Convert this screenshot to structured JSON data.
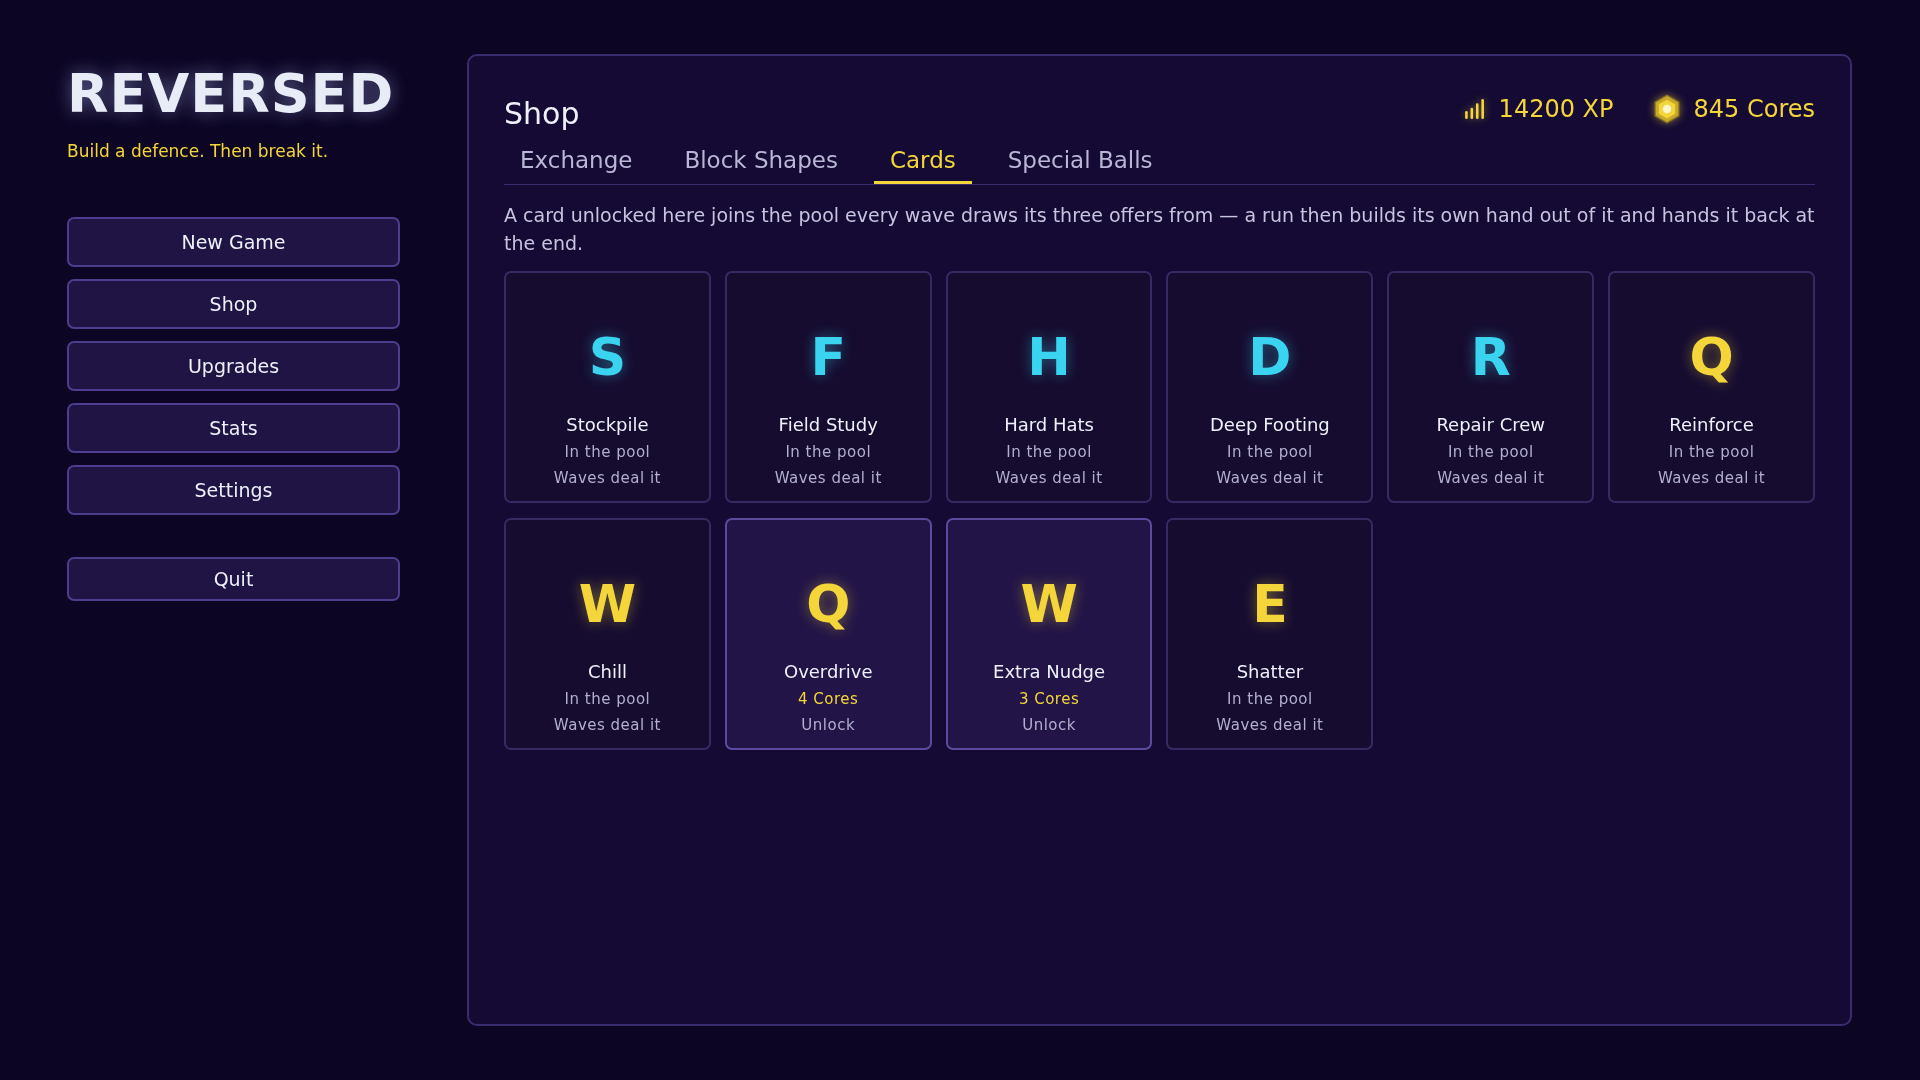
{
  "app": {
    "title": "REVERSED",
    "tagline": "Build a defence. Then break it."
  },
  "menu": [
    {
      "label": "New Game",
      "kind": "main"
    },
    {
      "label": "Shop",
      "kind": "main"
    },
    {
      "label": "Upgrades",
      "kind": "main"
    },
    {
      "label": "Stats",
      "kind": "main"
    },
    {
      "label": "Settings",
      "kind": "main"
    },
    {
      "label": "Quit",
      "kind": "exit"
    }
  ],
  "shop": {
    "title": "Shop",
    "xp": "14200 XP",
    "cores": "845 Cores",
    "tabs": [
      {
        "label": "Exchange",
        "selected": false
      },
      {
        "label": "Block Shapes",
        "selected": false
      },
      {
        "label": "Cards",
        "selected": true
      },
      {
        "label": "Special Balls",
        "selected": false
      }
    ],
    "description": "A card unlocked here joins the pool every wave draws its three offers from — a run then builds its own hand out of it and hands it back at the end.",
    "cards": [
      {
        "letter": "S",
        "color": "#3ad4f0",
        "name": "Stockpile",
        "status": "In the pool",
        "action": "Waves deal it",
        "owned": true
      },
      {
        "letter": "F",
        "color": "#3ad4f0",
        "name": "Field Study",
        "status": "In the pool",
        "action": "Waves deal it",
        "owned": true
      },
      {
        "letter": "H",
        "color": "#3ad4f0",
        "name": "Hard Hats",
        "status": "In the pool",
        "action": "Waves deal it",
        "owned": true
      },
      {
        "letter": "D",
        "color": "#3ad4f0",
        "name": "Deep Footing",
        "status": "In the pool",
        "action": "Waves deal it",
        "owned": true
      },
      {
        "letter": "R",
        "color": "#3ad4f0",
        "name": "Repair Crew",
        "status": "In the pool",
        "action": "Waves deal it",
        "owned": true
      },
      {
        "letter": "Q",
        "color": "#f5d63a",
        "name": "Reinforce",
        "status": "In the pool",
        "action": "Waves deal it",
        "owned": true
      },
      {
        "letter": "W",
        "color": "#f5d63a",
        "name": "Chill",
        "status": "In the pool",
        "action": "Waves deal it",
        "owned": true
      },
      {
        "letter": "Q",
        "color": "#f5d63a",
        "name": "Overdrive",
        "status": "4 Cores",
        "action": "Unlock",
        "owned": false
      },
      {
        "letter": "W",
        "color": "#f5d63a",
        "name": "Extra Nudge",
        "status": "3 Cores",
        "action": "Unlock",
        "owned": false
      },
      {
        "letter": "E",
        "color": "#f5d63a",
        "name": "Shatter",
        "status": "In the pool",
        "action": "Waves deal it",
        "owned": true
      }
    ]
  }
}
